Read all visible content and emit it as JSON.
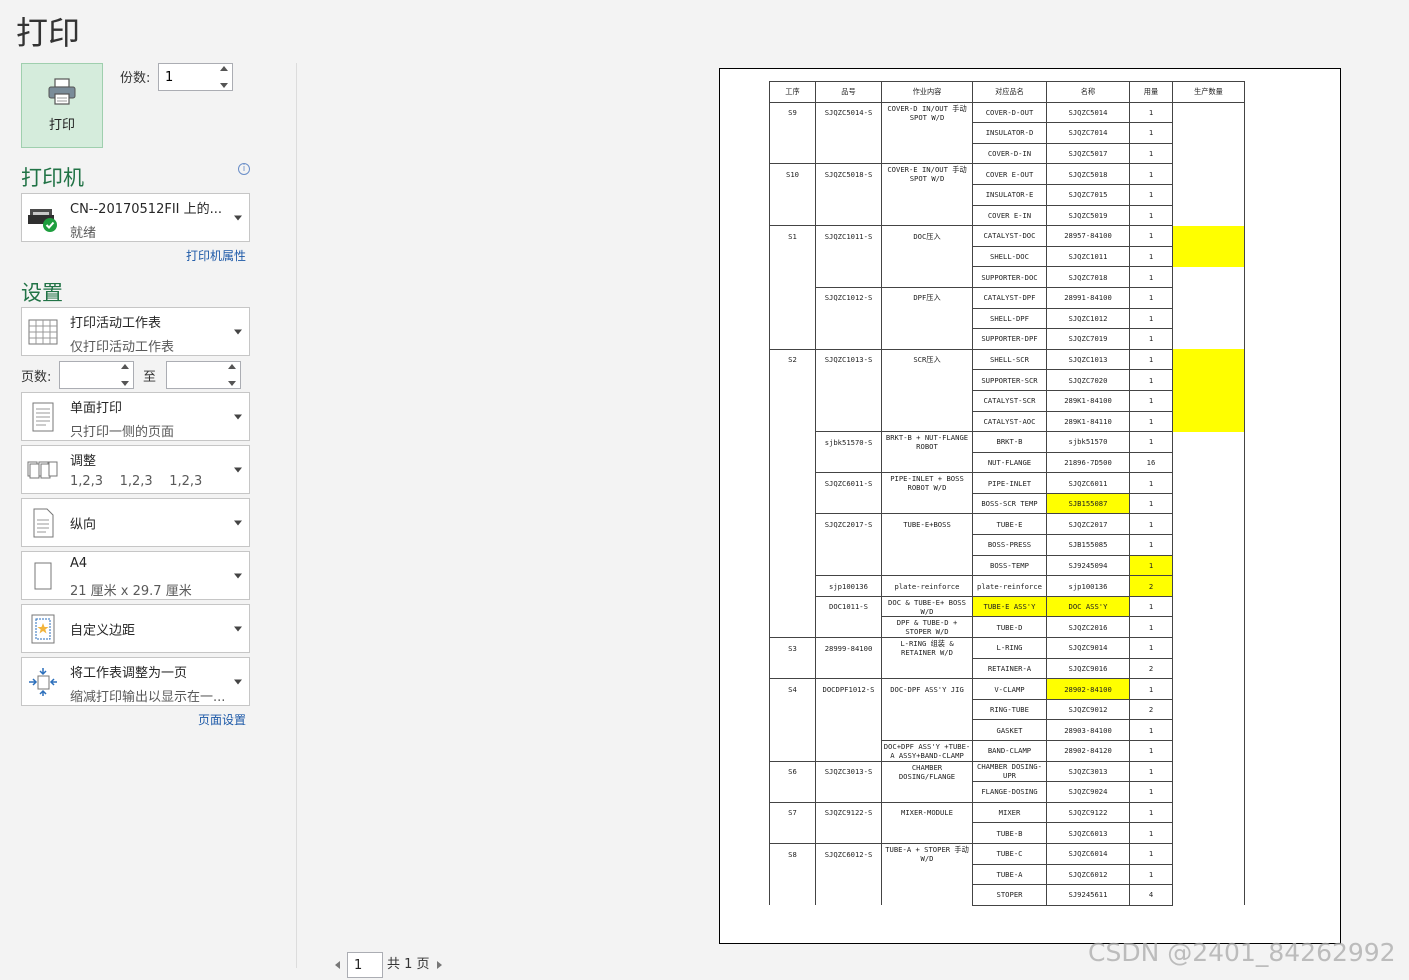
{
  "title": "打印",
  "print_button": {
    "label": "打印"
  },
  "copies": {
    "label": "份数:",
    "value": "1"
  },
  "printer_section": {
    "heading": "打印机",
    "info": "i",
    "printer_name": "CN--20170512FII 上的...",
    "printer_status": "就绪",
    "properties_link": "打印机属性"
  },
  "settings_section": {
    "heading": "设置",
    "what_to_print": {
      "title": "打印活动工作表",
      "subtitle": "仅打印活动工作表"
    },
    "pages": {
      "label": "页数:",
      "to_label": "至",
      "from_value": "",
      "to_value": ""
    },
    "sides": {
      "title": "单面打印",
      "subtitle": "只打印一侧的页面"
    },
    "collate": {
      "title": "调整",
      "subtitle": "1,2,3    1,2,3    1,2,3"
    },
    "orientation": {
      "title": "纵向"
    },
    "paper": {
      "title": "A4",
      "subtitle": "21 厘米 x 29.7 厘米"
    },
    "margins": {
      "title": "自定义边距"
    },
    "scaling": {
      "title": "将工作表调整为一页",
      "subtitle": "缩减打印输出以显示在一..."
    },
    "page_setup_link": "页面设置"
  },
  "navigation": {
    "current_page": "1",
    "total_label": "共 1 页"
  },
  "watermark": "CSDN @2401_84262992",
  "colors": {
    "accent": "#217346",
    "print_button_bg": "#d5ecdc",
    "highlight": "#ffff00",
    "link": "#1e5aa8"
  },
  "sheet": {
    "headers": [
      "工序",
      "品号",
      "作业内容",
      "对应品名",
      "名称",
      "用量",
      "生产数量"
    ],
    "rows": [
      [
        "S9",
        "SJQZC5014-S",
        "COVER-D IN/OUT 手动 SPOT W/D",
        "COVER-D-OUT",
        "SJQZC5014",
        "1",
        ""
      ],
      [
        "",
        "",
        "",
        "INSULATOR-D",
        "SJQZC7014",
        "1",
        ""
      ],
      [
        "",
        "",
        "",
        "COVER-D-IN",
        "SJQZC5017",
        "1",
        ""
      ],
      [
        "S10",
        "SJQZC5018-S",
        "COVER-E IN/OUT 手动 SPOT W/D",
        "COVER E-OUT",
        "SJQZC5018",
        "1",
        ""
      ],
      [
        "",
        "",
        "",
        "INSULATOR-E",
        "SJQZC7015",
        "1",
        ""
      ],
      [
        "",
        "",
        "",
        "COVER E-IN",
        "SJQZC5019",
        "1",
        ""
      ],
      [
        "S1",
        "SJQZC1011-S",
        "DOC压入",
        "CATALYST-DOC",
        "28957-84100",
        "1",
        ""
      ],
      [
        "",
        "",
        "",
        "SHELL-DOC",
        "SJQZC1011",
        "1",
        ""
      ],
      [
        "",
        "",
        "",
        "SUPPORTER-DOC",
        "SJQZC7018",
        "1",
        ""
      ],
      [
        "",
        "SJQZC1012-S",
        "DPF压入",
        "CATALYST-DPF",
        "28991-84100",
        "1",
        ""
      ],
      [
        "",
        "",
        "",
        "SHELL-DPF",
        "SJQZC1012",
        "1",
        ""
      ],
      [
        "",
        "",
        "",
        "SUPPORTER-DPF",
        "SJQZC7019",
        "1",
        ""
      ],
      [
        "S2",
        "SJQZC1013-S",
        "SCR压入",
        "SHELL-SCR",
        "SJQZC1013",
        "1",
        ""
      ],
      [
        "",
        "",
        "",
        "SUPPORTER-SCR",
        "SJQZC7020",
        "1",
        ""
      ],
      [
        "",
        "",
        "",
        "CATALYST-SCR",
        "289K1-84100",
        "1",
        ""
      ],
      [
        "",
        "",
        "",
        "CATALYST-AOC",
        "289K1-84110",
        "1",
        ""
      ],
      [
        "",
        "sjbk51570-S",
        "BRKT-B + NUT-FLANGE ROBOT",
        "BRKT-B",
        "sjbk51570",
        "1",
        ""
      ],
      [
        "",
        "",
        "",
        "NUT-FLANGE",
        "21896-7D500",
        "16",
        ""
      ],
      [
        "",
        "SJQZC6011-S",
        "PIPE-INLET + BOSS ROBOT W/D",
        "PIPE-INLET",
        "SJQZC6011",
        "1",
        ""
      ],
      [
        "",
        "",
        "",
        "BOSS-SCR TEMP",
        "SJB155087",
        "1",
        ""
      ],
      [
        "",
        "SJQZC2017-S",
        "TUBE-E+BOSS",
        "TUBE-E",
        "SJQZC2017",
        "1",
        ""
      ],
      [
        "",
        "",
        "",
        "BOSS-PRESS",
        "SJB155085",
        "1",
        ""
      ],
      [
        "",
        "",
        "",
        "BOSS-TEMP",
        "SJ9245094",
        "1",
        ""
      ],
      [
        "",
        "sjp100136",
        "plate-reinforce",
        "plate-reinforce",
        "sjp100136",
        "2",
        ""
      ],
      [
        "",
        "DOC1011-S",
        "DOC & TUBE-E+ BOSS W/D",
        "TUBE-E ASS'Y",
        "DOC ASS'Y",
        "1",
        ""
      ],
      [
        "",
        "",
        "DPF & TUBE-D + STOPER W/D",
        "TUBE-D",
        "SJQZC2016",
        "1",
        ""
      ],
      [
        "S3",
        "28999-84100",
        "L-RING 组装 & RETAINER W/D",
        "L-RING",
        "SJQZC9014",
        "1",
        ""
      ],
      [
        "",
        "",
        "",
        "RETAINER-A",
        "SJQZC9016",
        "2",
        ""
      ],
      [
        "S4",
        "DOCDPF1012-S",
        "DOC-DPF ASS'Y JIG",
        "V-CLAMP",
        "28902-84100",
        "1",
        ""
      ],
      [
        "",
        "",
        "",
        "RING-TUBE",
        "SJQZC9012",
        "2",
        ""
      ],
      [
        "",
        "",
        "",
        "GASKET",
        "28903-84100",
        "1",
        ""
      ],
      [
        "",
        "",
        "DOC+DPF ASS'Y +TUBE-A ASSY+BAND-CLAMP",
        "BAND-CLAMP",
        "28902-84120",
        "1",
        ""
      ],
      [
        "S6",
        "SJQZC3013-S",
        "CHAMBER DOSING/FLANGE",
        "CHAMBER DOSING-UPR",
        "SJQZC3013",
        "1",
        ""
      ],
      [
        "",
        "",
        "",
        "FLANGE-DOSING",
        "SJQZC9024",
        "1",
        ""
      ],
      [
        "S7",
        "SJQZC9122-S",
        "MIXER-MODULE",
        "MIXER",
        "SJQZC9122",
        "1",
        ""
      ],
      [
        "",
        "",
        "",
        "TUBE-B",
        "SJQZC6013",
        "1",
        ""
      ],
      [
        "S8",
        "SJQZC6012-S",
        "TUBE-A + STOPER 手动 W/D",
        "TUBE-C",
        "SJQZC6014",
        "1",
        ""
      ],
      [
        "",
        "",
        "",
        "TUBE-A",
        "SJQZC6012",
        "1",
        ""
      ],
      [
        "",
        "",
        "",
        "STOPER",
        "SJ9245611",
        "4",
        ""
      ]
    ]
  }
}
